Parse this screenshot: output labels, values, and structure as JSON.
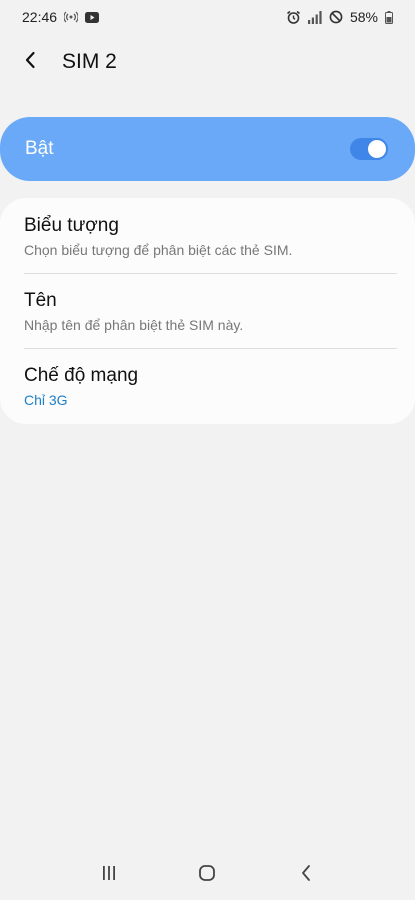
{
  "status_bar": {
    "time": "22:46",
    "battery_percent": "58%",
    "icons_left": [
      "wireless-signal-icon",
      "youtube-icon"
    ],
    "icons_right": [
      "alarm-icon",
      "cell-signal-icon",
      "do-not-disturb-icon",
      "battery-icon"
    ]
  },
  "header": {
    "title": "SIM 2",
    "back_icon": "chevron-left-icon"
  },
  "toggle": {
    "label": "Bật",
    "state": "on",
    "accent_color": "#6aa9f8"
  },
  "settings": [
    {
      "title": "Biểu tượng",
      "subtitle": "Chọn biểu tượng để phân biệt các thẻ SIM."
    },
    {
      "title": "Tên",
      "subtitle": "Nhập tên để phân biệt thẻ SIM này."
    },
    {
      "title": "Chế độ mạng",
      "subtitle": "Chỉ 3G",
      "subtitle_color": "#1d7fc7"
    }
  ],
  "nav_bar": {
    "buttons": [
      "recent-apps-icon",
      "home-icon",
      "back-icon"
    ]
  }
}
